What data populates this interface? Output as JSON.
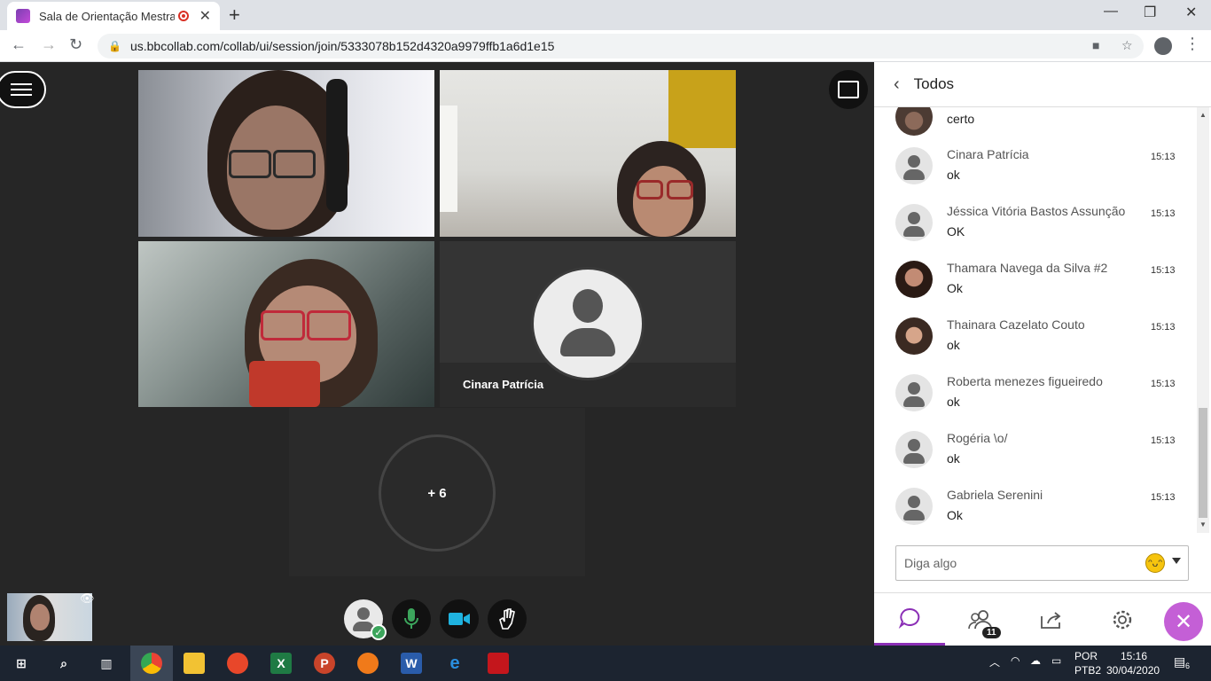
{
  "browser": {
    "tab_title": "Sala de Orientação Mestrado",
    "url": "us.bbcollab.com/collab/ui/session/join/5333078b152d4320a9979ffb1a6d1e15"
  },
  "stage": {
    "participant_name": "Cinara Patrícia",
    "overflow_count": "+ 6"
  },
  "panel": {
    "title": "Todos",
    "partial_first_message": "certo",
    "messages": [
      {
        "sender": "Cinara Patrícia",
        "time": "15:13",
        "text": "ok"
      },
      {
        "sender": "Jéssica Vitória Bastos Assunção",
        "time": "15:13",
        "text": "OK"
      },
      {
        "sender": "Thamara Navega da Silva #2",
        "time": "15:13",
        "text": "Ok"
      },
      {
        "sender": "Thainara Cazelato Couto",
        "time": "15:13",
        "text": "ok"
      },
      {
        "sender": "Roberta menezes figueiredo",
        "time": "15:13",
        "text": "ok"
      },
      {
        "sender": "Rogéria \\o/",
        "time": "15:13",
        "text": "ok"
      },
      {
        "sender": "Gabriela Serenini",
        "time": "15:13",
        "text": "Ok"
      }
    ],
    "input_placeholder": "Diga algo",
    "participants_badge": "11"
  },
  "taskbar": {
    "lang_top": "POR",
    "lang_bottom": "PTB2",
    "time": "15:16",
    "date": "30/04/2020",
    "notifications": "6"
  },
  "colors": {
    "accent": "#8b2fb6",
    "close": "#c45fd6",
    "mic": "#3ca55c",
    "camera": "#1fb3e0"
  }
}
